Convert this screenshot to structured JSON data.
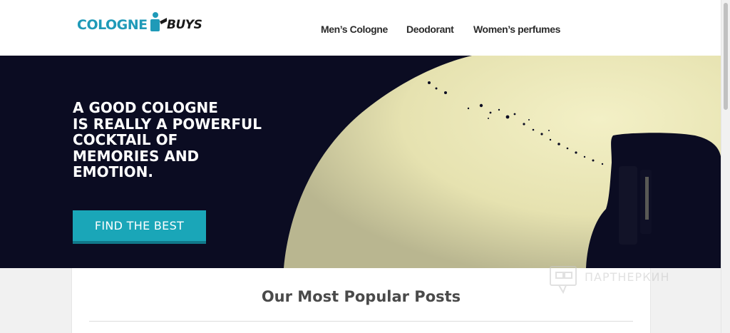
{
  "logo": {
    "left_text": "COLOGNE",
    "right_text": "BUYS",
    "colors": {
      "primary": "#1f9ab8",
      "secondary": "#1a1a1a"
    }
  },
  "nav": {
    "items": [
      {
        "label": "Men’s Cologne"
      },
      {
        "label": "Deodorant"
      },
      {
        "label": "Women’s perfumes"
      }
    ]
  },
  "hero": {
    "headline_lines": [
      "A GOOD COLOGNE",
      "IS REALLY A POWERFUL",
      "COCKTAIL OF",
      "MEMORIES AND",
      "EMOTION."
    ],
    "cta_label": "FIND THE BEST",
    "colors": {
      "background": "#0b0c22",
      "cta": "#1aa6b8",
      "image_light": "#e9e6b8"
    }
  },
  "content": {
    "section_title": "Our Most Popular Posts"
  },
  "watermark": {
    "text": "ПАРТНЕРКИН",
    "icon": "chat-bubble-icon"
  }
}
